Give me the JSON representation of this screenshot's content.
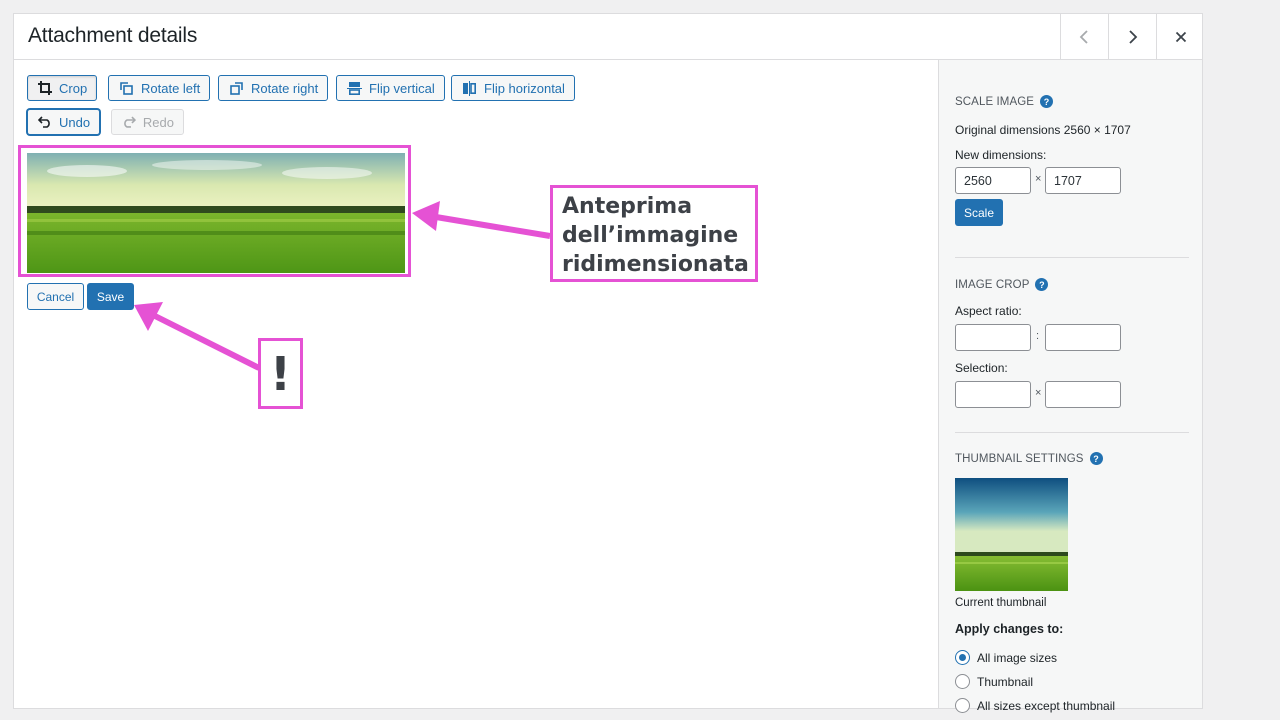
{
  "header": {
    "title": "Attachment details"
  },
  "toolbar": {
    "crop": "Crop",
    "rotate_left": "Rotate left",
    "rotate_right": "Rotate right",
    "flip_vertical": "Flip vertical",
    "flip_horizontal": "Flip horizontal",
    "undo": "Undo",
    "redo": "Redo"
  },
  "actions": {
    "cancel": "Cancel",
    "save": "Save"
  },
  "sidebar": {
    "scale": {
      "title": "Scale Image",
      "original": "Original dimensions 2560 × 1707",
      "new_label": "New dimensions:",
      "width": "2560",
      "height": "1707",
      "sep": "×",
      "button": "Scale"
    },
    "crop": {
      "title": "Image Crop",
      "aspect_label": "Aspect ratio:",
      "aspect_sep": ":",
      "selection_label": "Selection:",
      "selection_sep": "×"
    },
    "thumbnail": {
      "title": "Thumbnail Settings",
      "caption": "Current thumbnail",
      "apply_label": "Apply changes to:",
      "options": [
        "All image sizes",
        "Thumbnail",
        "All sizes except thumbnail"
      ],
      "selected_index": 0
    },
    "help_glyph": "?"
  },
  "annotations": {
    "preview_label": "Anteprima\ndell’immagine\nridimensionata",
    "exclamation": "!",
    "color": "#e552d4"
  },
  "colors": {
    "accent": "#2271b1",
    "border": "#dcdcde"
  }
}
